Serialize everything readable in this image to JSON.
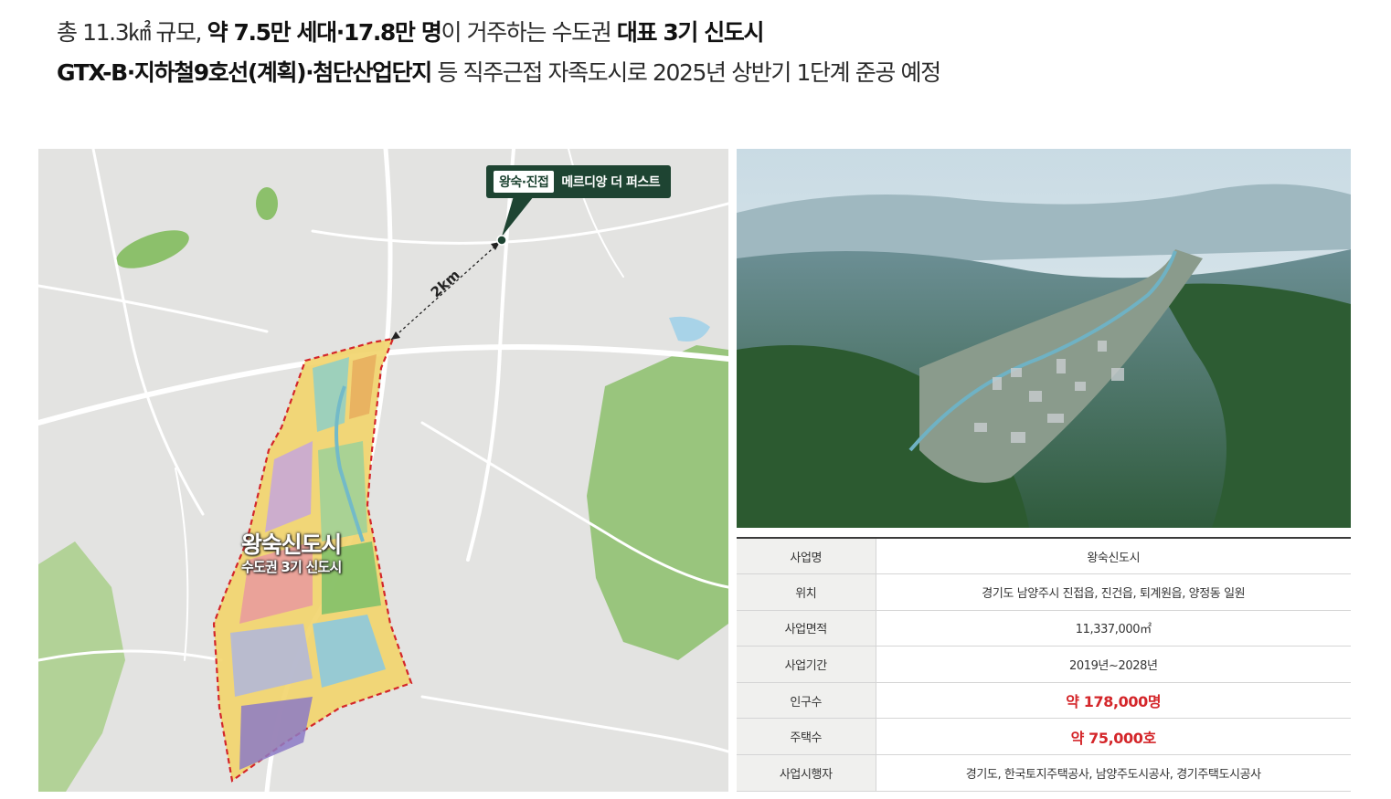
{
  "headline": {
    "line1": [
      {
        "text": "총 11.3㎢ 규모, ",
        "bold": false
      },
      {
        "text": "약 7.5만 세대·17.8만 명",
        "bold": true
      },
      {
        "text": "이 거주하는 수도권 ",
        "bold": false
      },
      {
        "text": "대표 3기 신도시",
        "bold": true
      }
    ],
    "line2": [
      {
        "text": "GTX-B·지하철9호선(계획)·첨단산업단지",
        "bold": true
      },
      {
        "text": " 등 직주근접 자족도시로 2025년 상반기 1단계 준공 예정",
        "bold": false
      }
    ]
  },
  "map": {
    "pin_tag": "왕숙·진접",
    "pin_name": "메르디앙 더 퍼스트",
    "distance_label": "2km",
    "city_name": "왕숙신도시",
    "city_sub": "수도권 3기 신도시",
    "colors": {
      "background": "#e3e3e1",
      "green_area": "#8cc06b",
      "boundary": "#d4262a",
      "pin": "#1e4432"
    }
  },
  "table": {
    "rows": [
      {
        "key": "사업명",
        "value": "왕숙신도시",
        "highlight": false
      },
      {
        "key": "위치",
        "value": "경기도 남양주시 진접읍, 진건읍, 퇴계원읍, 양정동 일원",
        "highlight": false
      },
      {
        "key": "사업면적",
        "value": "11,337,000㎡",
        "highlight": false
      },
      {
        "key": "사업기간",
        "value": "2019년~2028년",
        "highlight": false
      },
      {
        "key": "인구수",
        "value": "약 178,000명",
        "highlight": true
      },
      {
        "key": "주택수",
        "value": "약 75,000호",
        "highlight": true
      },
      {
        "key": "사업시행자",
        "value": "경기도, 한국토지주택공사, 남양주도시공사, 경기주택도시공사",
        "highlight": false
      }
    ]
  }
}
